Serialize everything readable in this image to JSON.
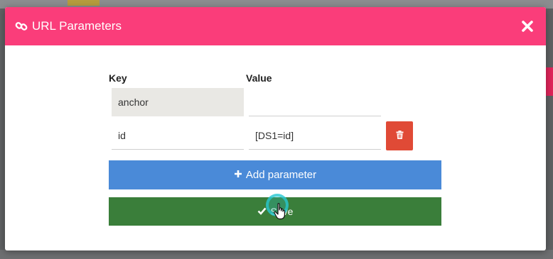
{
  "dialog": {
    "title": "URL Parameters",
    "header_color": "#fa3d7a"
  },
  "table": {
    "key_header": "Key",
    "value_header": "Value",
    "rows": [
      {
        "key": "anchor",
        "value": "",
        "key_readonly": true
      },
      {
        "key": "id",
        "value": "[DS1=id]",
        "key_readonly": false
      }
    ]
  },
  "buttons": {
    "add_label": "Add parameter",
    "save_label": "Save",
    "add_color": "#4a8ad8",
    "save_color": "#3a7e3a",
    "delete_color": "#e04a36"
  },
  "icons": {
    "header": "link-icon",
    "close": "close-icon",
    "delete": "trash-icon",
    "add": "plus-icon",
    "save": "check-icon"
  }
}
